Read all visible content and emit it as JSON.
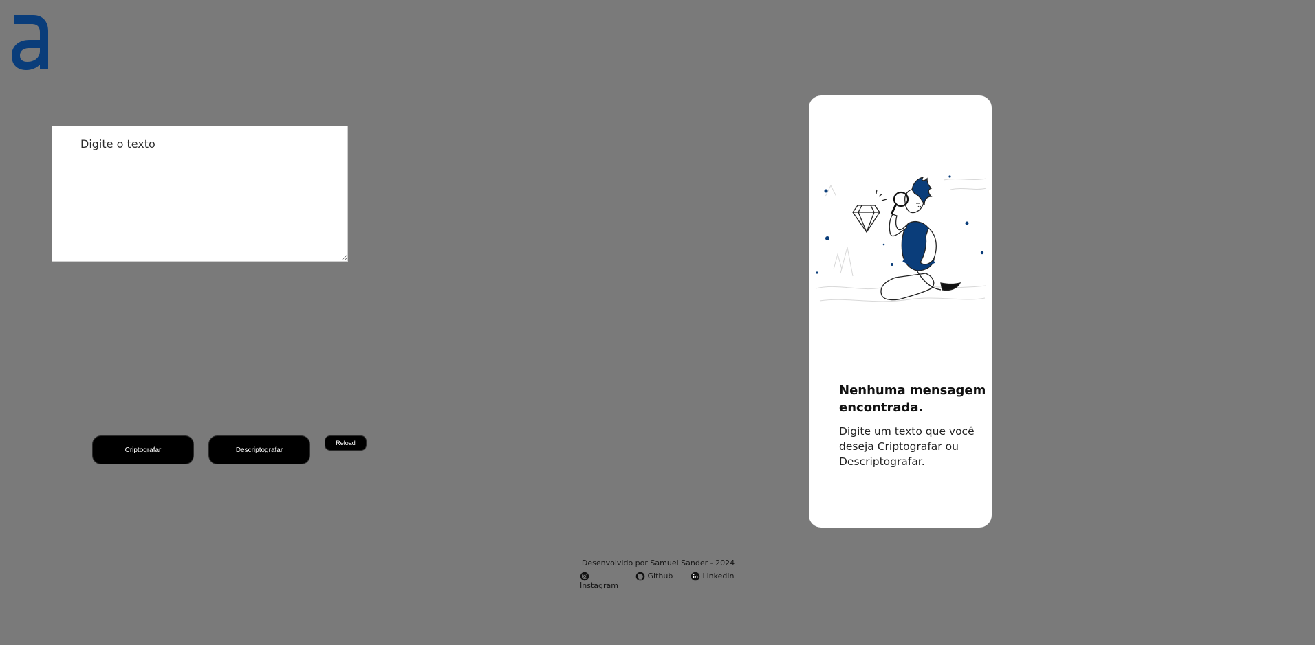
{
  "logo": {
    "letter": "a",
    "color": "#0a3d7a"
  },
  "input": {
    "placeholder": "Digite o texto",
    "value": ""
  },
  "buttons": {
    "encrypt_label": "Criptografar",
    "decrypt_label": "Descriptografar",
    "reload_label": "Reload"
  },
  "result": {
    "illustration": "person-with-magnifying-glass-examining-diamond",
    "title": "Nenhuma mensagem encontrada.",
    "text": "Digite um texto que você deseja Criptografar ou Descriptografar."
  },
  "footer": {
    "credit": "Desenvolvido por Samuel Sander - 2024",
    "links": [
      {
        "label": "Instagram",
        "icon": "instagram-icon"
      },
      {
        "label": "Github",
        "icon": "github-icon"
      },
      {
        "label": "Linkedin",
        "icon": "linkedin-icon"
      }
    ]
  },
  "colors": {
    "background": "#7a7a7a",
    "brand": "#0a3d7a",
    "button": "#000000",
    "card": "#ffffff"
  }
}
